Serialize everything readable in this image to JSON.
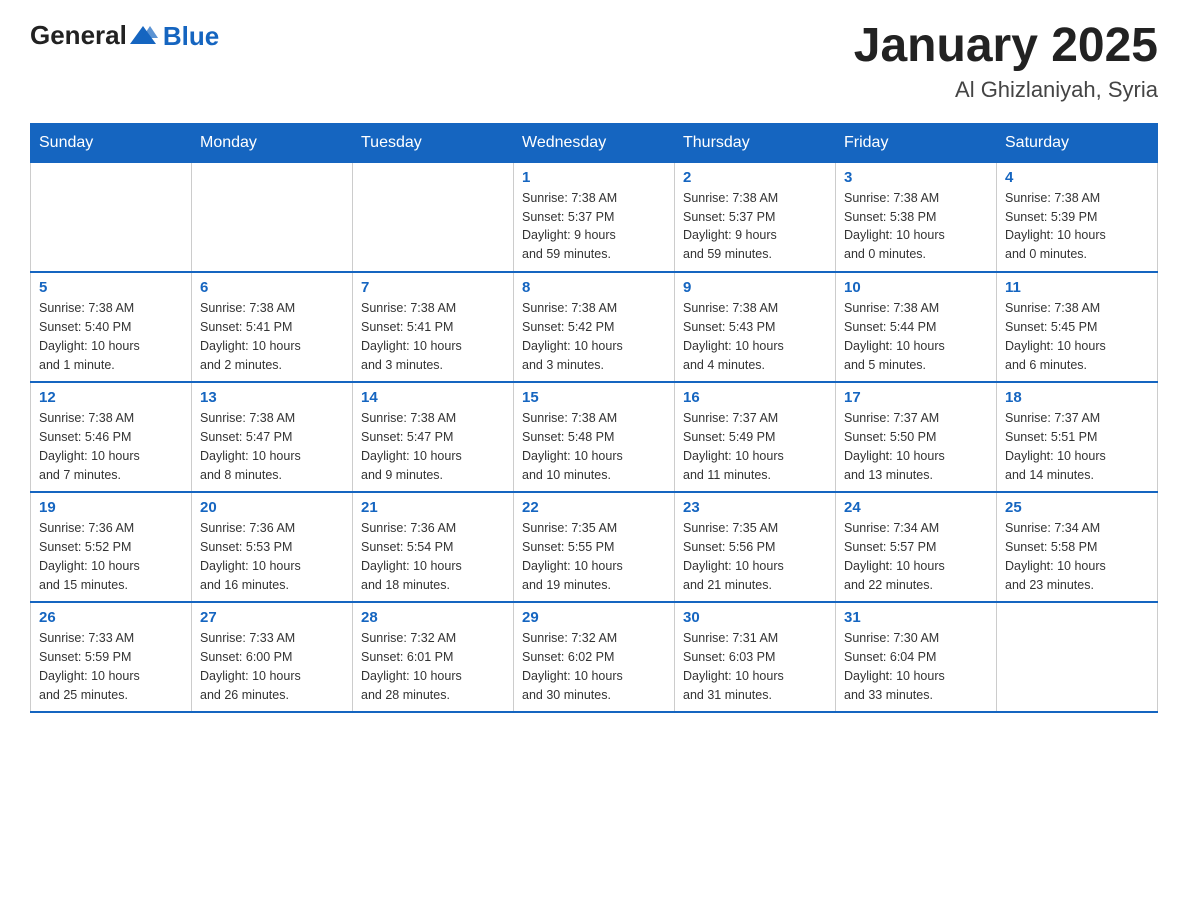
{
  "logo": {
    "general": "General",
    "blue": "Blue"
  },
  "title": "January 2025",
  "location": "Al Ghizlaniyah, Syria",
  "days_of_week": [
    "Sunday",
    "Monday",
    "Tuesday",
    "Wednesday",
    "Thursday",
    "Friday",
    "Saturday"
  ],
  "weeks": [
    [
      {
        "num": "",
        "info": ""
      },
      {
        "num": "",
        "info": ""
      },
      {
        "num": "",
        "info": ""
      },
      {
        "num": "1",
        "info": "Sunrise: 7:38 AM\nSunset: 5:37 PM\nDaylight: 9 hours\nand 59 minutes."
      },
      {
        "num": "2",
        "info": "Sunrise: 7:38 AM\nSunset: 5:37 PM\nDaylight: 9 hours\nand 59 minutes."
      },
      {
        "num": "3",
        "info": "Sunrise: 7:38 AM\nSunset: 5:38 PM\nDaylight: 10 hours\nand 0 minutes."
      },
      {
        "num": "4",
        "info": "Sunrise: 7:38 AM\nSunset: 5:39 PM\nDaylight: 10 hours\nand 0 minutes."
      }
    ],
    [
      {
        "num": "5",
        "info": "Sunrise: 7:38 AM\nSunset: 5:40 PM\nDaylight: 10 hours\nand 1 minute."
      },
      {
        "num": "6",
        "info": "Sunrise: 7:38 AM\nSunset: 5:41 PM\nDaylight: 10 hours\nand 2 minutes."
      },
      {
        "num": "7",
        "info": "Sunrise: 7:38 AM\nSunset: 5:41 PM\nDaylight: 10 hours\nand 3 minutes."
      },
      {
        "num": "8",
        "info": "Sunrise: 7:38 AM\nSunset: 5:42 PM\nDaylight: 10 hours\nand 3 minutes."
      },
      {
        "num": "9",
        "info": "Sunrise: 7:38 AM\nSunset: 5:43 PM\nDaylight: 10 hours\nand 4 minutes."
      },
      {
        "num": "10",
        "info": "Sunrise: 7:38 AM\nSunset: 5:44 PM\nDaylight: 10 hours\nand 5 minutes."
      },
      {
        "num": "11",
        "info": "Sunrise: 7:38 AM\nSunset: 5:45 PM\nDaylight: 10 hours\nand 6 minutes."
      }
    ],
    [
      {
        "num": "12",
        "info": "Sunrise: 7:38 AM\nSunset: 5:46 PM\nDaylight: 10 hours\nand 7 minutes."
      },
      {
        "num": "13",
        "info": "Sunrise: 7:38 AM\nSunset: 5:47 PM\nDaylight: 10 hours\nand 8 minutes."
      },
      {
        "num": "14",
        "info": "Sunrise: 7:38 AM\nSunset: 5:47 PM\nDaylight: 10 hours\nand 9 minutes."
      },
      {
        "num": "15",
        "info": "Sunrise: 7:38 AM\nSunset: 5:48 PM\nDaylight: 10 hours\nand 10 minutes."
      },
      {
        "num": "16",
        "info": "Sunrise: 7:37 AM\nSunset: 5:49 PM\nDaylight: 10 hours\nand 11 minutes."
      },
      {
        "num": "17",
        "info": "Sunrise: 7:37 AM\nSunset: 5:50 PM\nDaylight: 10 hours\nand 13 minutes."
      },
      {
        "num": "18",
        "info": "Sunrise: 7:37 AM\nSunset: 5:51 PM\nDaylight: 10 hours\nand 14 minutes."
      }
    ],
    [
      {
        "num": "19",
        "info": "Sunrise: 7:36 AM\nSunset: 5:52 PM\nDaylight: 10 hours\nand 15 minutes."
      },
      {
        "num": "20",
        "info": "Sunrise: 7:36 AM\nSunset: 5:53 PM\nDaylight: 10 hours\nand 16 minutes."
      },
      {
        "num": "21",
        "info": "Sunrise: 7:36 AM\nSunset: 5:54 PM\nDaylight: 10 hours\nand 18 minutes."
      },
      {
        "num": "22",
        "info": "Sunrise: 7:35 AM\nSunset: 5:55 PM\nDaylight: 10 hours\nand 19 minutes."
      },
      {
        "num": "23",
        "info": "Sunrise: 7:35 AM\nSunset: 5:56 PM\nDaylight: 10 hours\nand 21 minutes."
      },
      {
        "num": "24",
        "info": "Sunrise: 7:34 AM\nSunset: 5:57 PM\nDaylight: 10 hours\nand 22 minutes."
      },
      {
        "num": "25",
        "info": "Sunrise: 7:34 AM\nSunset: 5:58 PM\nDaylight: 10 hours\nand 23 minutes."
      }
    ],
    [
      {
        "num": "26",
        "info": "Sunrise: 7:33 AM\nSunset: 5:59 PM\nDaylight: 10 hours\nand 25 minutes."
      },
      {
        "num": "27",
        "info": "Sunrise: 7:33 AM\nSunset: 6:00 PM\nDaylight: 10 hours\nand 26 minutes."
      },
      {
        "num": "28",
        "info": "Sunrise: 7:32 AM\nSunset: 6:01 PM\nDaylight: 10 hours\nand 28 minutes."
      },
      {
        "num": "29",
        "info": "Sunrise: 7:32 AM\nSunset: 6:02 PM\nDaylight: 10 hours\nand 30 minutes."
      },
      {
        "num": "30",
        "info": "Sunrise: 7:31 AM\nSunset: 6:03 PM\nDaylight: 10 hours\nand 31 minutes."
      },
      {
        "num": "31",
        "info": "Sunrise: 7:30 AM\nSunset: 6:04 PM\nDaylight: 10 hours\nand 33 minutes."
      },
      {
        "num": "",
        "info": ""
      }
    ]
  ]
}
